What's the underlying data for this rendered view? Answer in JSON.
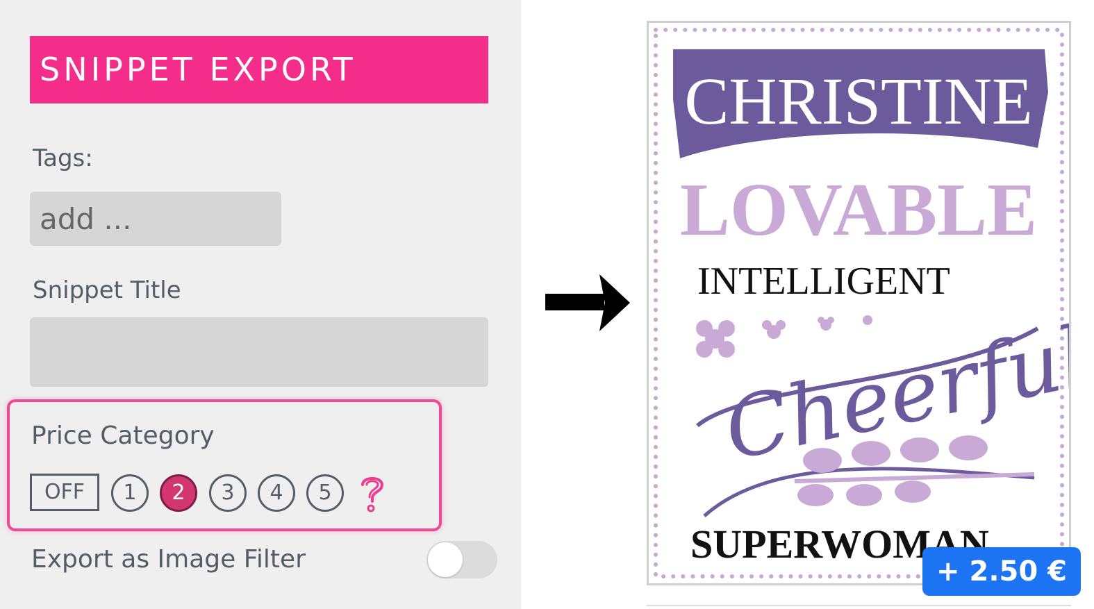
{
  "panel": {
    "header": "SNIPPET EXPORT",
    "tags_label": "Tags:",
    "tags_placeholder": "add ...",
    "title_label": "Snippet Title",
    "title_value": "",
    "price_label": "Price Category",
    "price_options": [
      "OFF",
      "1",
      "2",
      "3",
      "4",
      "5"
    ],
    "price_selected": "2",
    "export_label": "Export as Image Filter",
    "export_toggle_on": false
  },
  "preview": {
    "lines": [
      "CHRISTINE",
      "LOVABLE",
      "INTELLIGENT",
      "Cheerful",
      "SUPERWOMAN"
    ],
    "price_badge": "+ 2.50 €"
  },
  "colors": {
    "header_bg": "#f52d8a",
    "highlight": "#ee4a94",
    "selected": "#d2386f",
    "purple_dark": "#6b5a9c",
    "purple_light": "#c9a9d6",
    "badge": "#1d74f2"
  }
}
